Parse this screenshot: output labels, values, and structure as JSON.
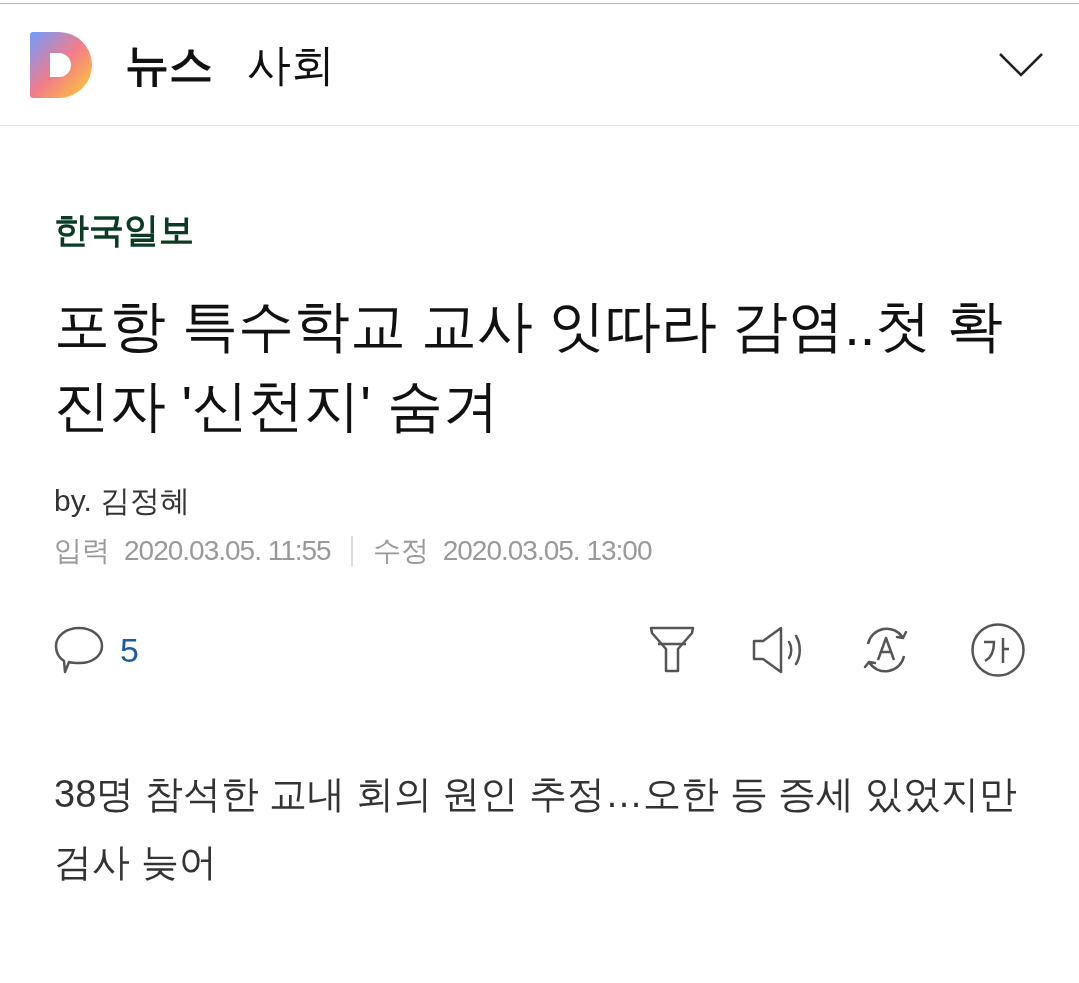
{
  "header": {
    "section": "뉴스",
    "category": "사회"
  },
  "article": {
    "source": "한국일보",
    "headline": "포항 특수학교 교사 잇따라 감염..첫 확진자 '신천지' 숨겨",
    "byline": "by. 김정혜",
    "published_label": "입력",
    "published": "2020.03.05. 11:55",
    "modified_label": "수정",
    "modified": "2020.03.05. 13:00"
  },
  "toolbar": {
    "comment_count": "5"
  },
  "summary": "38명 참석한 교내 회의 원인 추정…오한 등 증세 있었지만 검사 늦어"
}
